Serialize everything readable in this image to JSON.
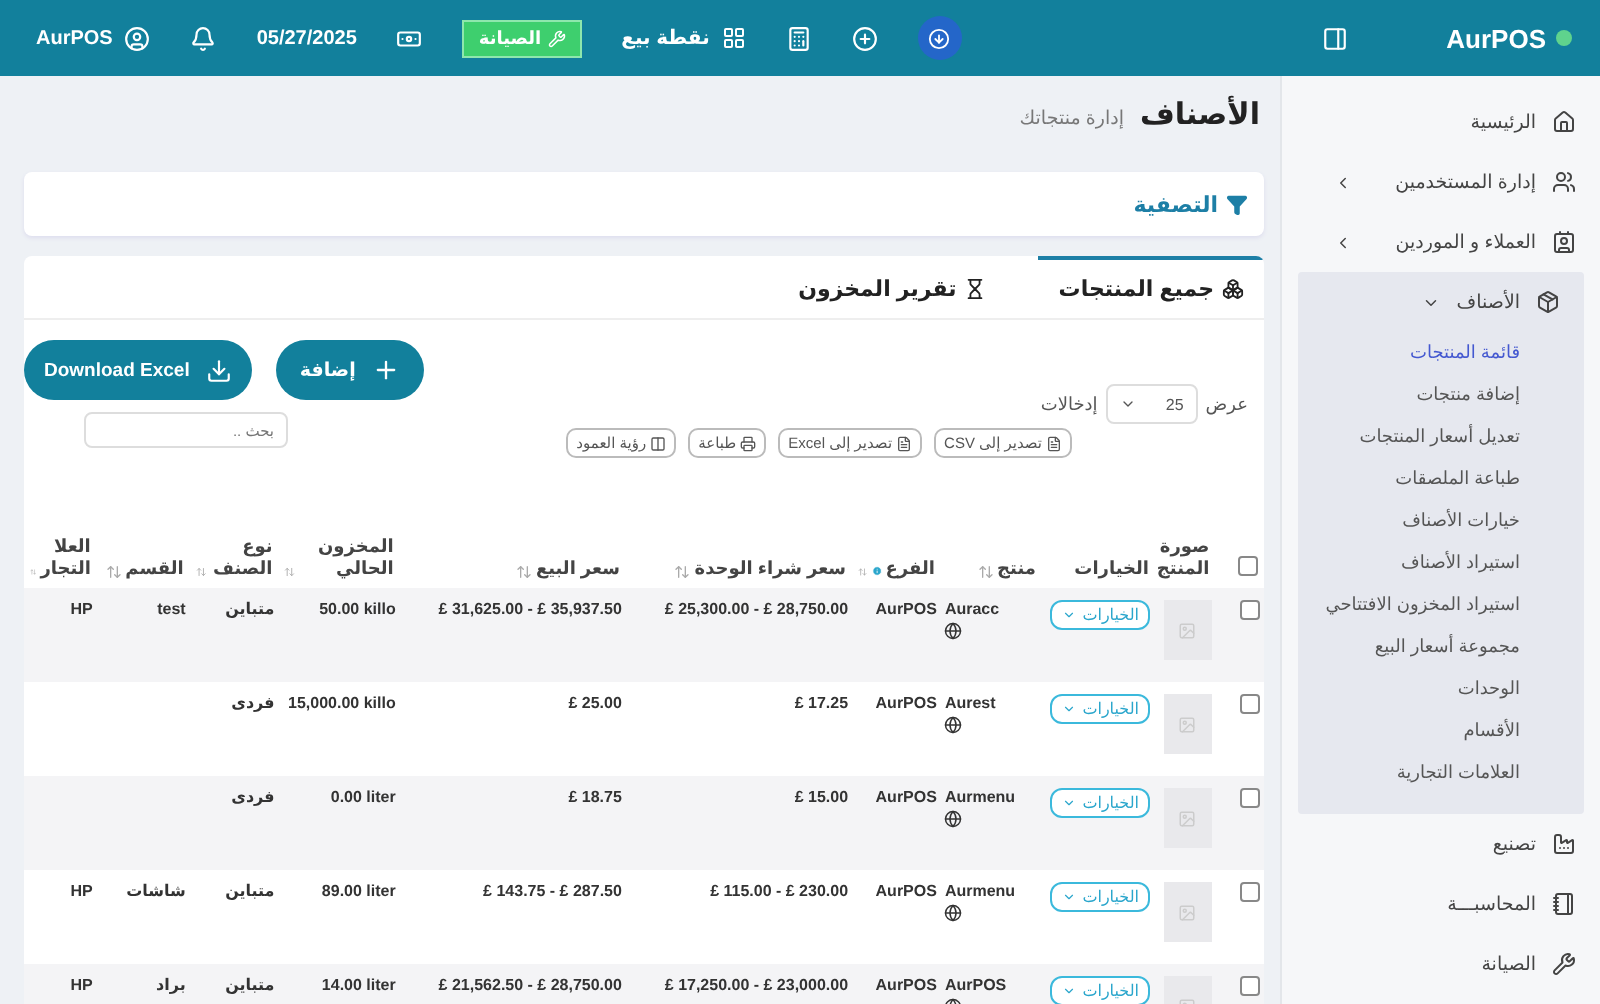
{
  "header": {
    "brand": "AurPOS",
    "pos_label": "نقطة بيع",
    "maintenance_button": "الصيانة",
    "date": "05/27/2025",
    "user": "AurPOS"
  },
  "sidebar": {
    "items": [
      {
        "kind": "link",
        "label": "الرئيسية"
      },
      {
        "kind": "group",
        "label": "إدارة المستخدمين",
        "expanded": false
      },
      {
        "kind": "group",
        "label": "العملاء و الموردين",
        "expanded": false
      },
      {
        "kind": "group",
        "label": "الأصناف",
        "expanded": true,
        "children": [
          {
            "label": "قائمة المنتجات",
            "selected": true
          },
          {
            "label": "إضافة منتجات",
            "selected": false
          },
          {
            "label": "تعديل أسعار المنتجات",
            "selected": false
          },
          {
            "label": "طباعة الملصقات",
            "selected": false
          },
          {
            "label": "خيارات الأصناف",
            "selected": false
          },
          {
            "label": "استيراد الأصناف",
            "selected": false
          },
          {
            "label": "استيراد المخزون الافتتاحي",
            "selected": false
          },
          {
            "label": "مجموعة أسعار البيع",
            "selected": false
          },
          {
            "label": "الوحدات",
            "selected": false
          },
          {
            "label": "الأقسام",
            "selected": false
          },
          {
            "label": "العلامات التجارية",
            "selected": false
          }
        ]
      },
      {
        "kind": "link",
        "label": "تصنيع"
      },
      {
        "kind": "link",
        "label": "المحاسبـــة"
      },
      {
        "kind": "link",
        "label": "الصيانة"
      }
    ]
  },
  "page": {
    "title": "الأصناف",
    "subtitle": "إدارة منتجاتك"
  },
  "filter": {
    "label": "التصفية"
  },
  "tabs": [
    {
      "label": "جميع المنتجات",
      "selected": true
    },
    {
      "label": "تقرير المخزون",
      "selected": false
    }
  ],
  "actions": {
    "add": "إضافة",
    "download": "Download Excel"
  },
  "entries": {
    "show": "عرض",
    "value": "25",
    "suffix": "إدخالات"
  },
  "exports": [
    "تصدير إلى CSV",
    "تصدير إلى Excel",
    "طباعة",
    "رؤية العمود"
  ],
  "search": {
    "placeholder": "بحث .."
  },
  "table": {
    "header_checked": false,
    "columns": [
      "صورة المنتج",
      "الخيارات",
      "منتج",
      "الفرع",
      "سعر شراء الوحدة",
      "سعر البيع",
      "المخزون الحالي",
      "نوع الصنف",
      "القسم",
      "العلا التجار"
    ],
    "rows": [
      {
        "checked": false,
        "options": "الخيارات",
        "product": "Auracc",
        "branch": "AurPOS",
        "purchase": "£ 25,300.00 - £ 28,750.00",
        "sale": "£ 31,625.00 - £ 35,937.50",
        "stock": "50.00 killo",
        "type": "متباين",
        "category": "test",
        "brand": "HP"
      },
      {
        "checked": false,
        "options": "الخيارات",
        "product": "Aurest",
        "branch": "AurPOS",
        "purchase": "£ 17.25",
        "sale": "£ 25.00",
        "stock": "15,000.00 killo",
        "type": "فردى"
      },
      {
        "checked": false,
        "options": "الخيارات",
        "product": "Aurmenu",
        "branch": "AurPOS",
        "purchase": "£ 15.00",
        "sale": "£ 18.75",
        "stock": "0.00 liter",
        "type": "فردى"
      },
      {
        "checked": false,
        "options": "الخيارات",
        "product": "Aurmenu",
        "branch": "AurPOS",
        "purchase": "£ 115.00 - £ 230.00",
        "sale": "£ 143.75 - £ 287.50",
        "stock": "89.00 liter",
        "type": "متباين",
        "category": "شاشات",
        "brand": "HP"
      },
      {
        "checked": false,
        "options": "الخيارات",
        "product": "AurPOS",
        "branch": "AurPOS",
        "purchase": "£ 17,250.00 - £ 23,000.00",
        "sale": "£ 21,562.50 - £ 28,750.00",
        "stock": "14.00 liter",
        "type": "متباين",
        "category": "براد",
        "brand": "HP"
      }
    ]
  }
}
